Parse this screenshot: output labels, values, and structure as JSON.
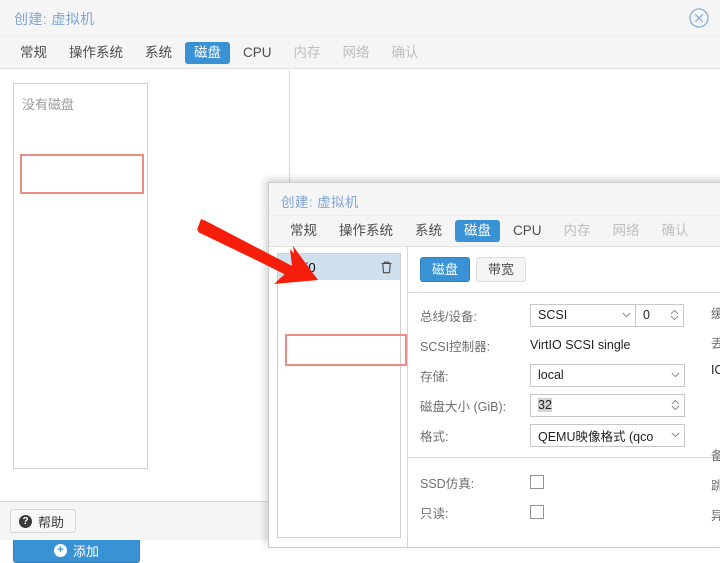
{
  "outer_dialog": {
    "title": "创建: 虚拟机",
    "close_icon": "close-circle-icon",
    "tabs": [
      {
        "label": "常规",
        "state": "normal"
      },
      {
        "label": "操作系统",
        "state": "normal"
      },
      {
        "label": "系统",
        "state": "normal"
      },
      {
        "label": "磁盘",
        "state": "active"
      },
      {
        "label": "CPU",
        "state": "normal"
      },
      {
        "label": "内存",
        "state": "disabled"
      },
      {
        "label": "网络",
        "state": "disabled"
      },
      {
        "label": "确认",
        "state": "disabled"
      }
    ],
    "disk_list_placeholder": "没有磁盘",
    "add_button": {
      "label": "添加",
      "icon": "plus-circle-icon"
    },
    "help_button": {
      "label": "帮助",
      "icon": "question-circle-icon"
    }
  },
  "inner_dialog": {
    "title": "创建: 虚拟机",
    "tabs": [
      {
        "label": "常规",
        "state": "normal"
      },
      {
        "label": "操作系统",
        "state": "normal"
      },
      {
        "label": "系统",
        "state": "normal"
      },
      {
        "label": "磁盘",
        "state": "active"
      },
      {
        "label": "CPU",
        "state": "normal"
      },
      {
        "label": "内存",
        "state": "disabled"
      },
      {
        "label": "网络",
        "state": "disabled"
      },
      {
        "label": "确认",
        "state": "disabled"
      }
    ],
    "disk_items": [
      {
        "name": "scsi0",
        "delete_icon": "trash-icon",
        "selected": true
      }
    ],
    "subtabs": [
      {
        "label": "磁盘",
        "state": "active"
      },
      {
        "label": "带宽",
        "state": "normal"
      }
    ],
    "form": {
      "bus_device": {
        "label": "总线/设备:",
        "bus_value": "SCSI",
        "device_value": "0"
      },
      "scsi_controller": {
        "label": "SCSI控制器:",
        "value": "VirtIO SCSI single"
      },
      "storage": {
        "label": "存储:",
        "value": "local"
      },
      "disk_size": {
        "label": "磁盘大小 (GiB):",
        "value": "32"
      },
      "format": {
        "label": "格式:",
        "value": "QEMU映像格式 (qco"
      },
      "ssd_emulation": {
        "label": "SSD仿真:",
        "checked": false
      },
      "read_only": {
        "label": "只读:",
        "checked": false
      }
    },
    "right_clipped_labels": [
      {
        "text": "缓存",
        "tone": "muted"
      },
      {
        "text": "丢弃",
        "tone": "muted"
      },
      {
        "text": "IO",
        "tone": "dark"
      },
      {
        "text": "备份",
        "tone": "muted"
      },
      {
        "text": "跳过",
        "tone": "muted"
      },
      {
        "text": "异步",
        "tone": "muted"
      }
    ]
  },
  "annotations": {
    "arrow": {
      "color": "#f51e0b",
      "name": "red-pointer-arrow"
    },
    "highlight_color": "#ef8a85"
  }
}
